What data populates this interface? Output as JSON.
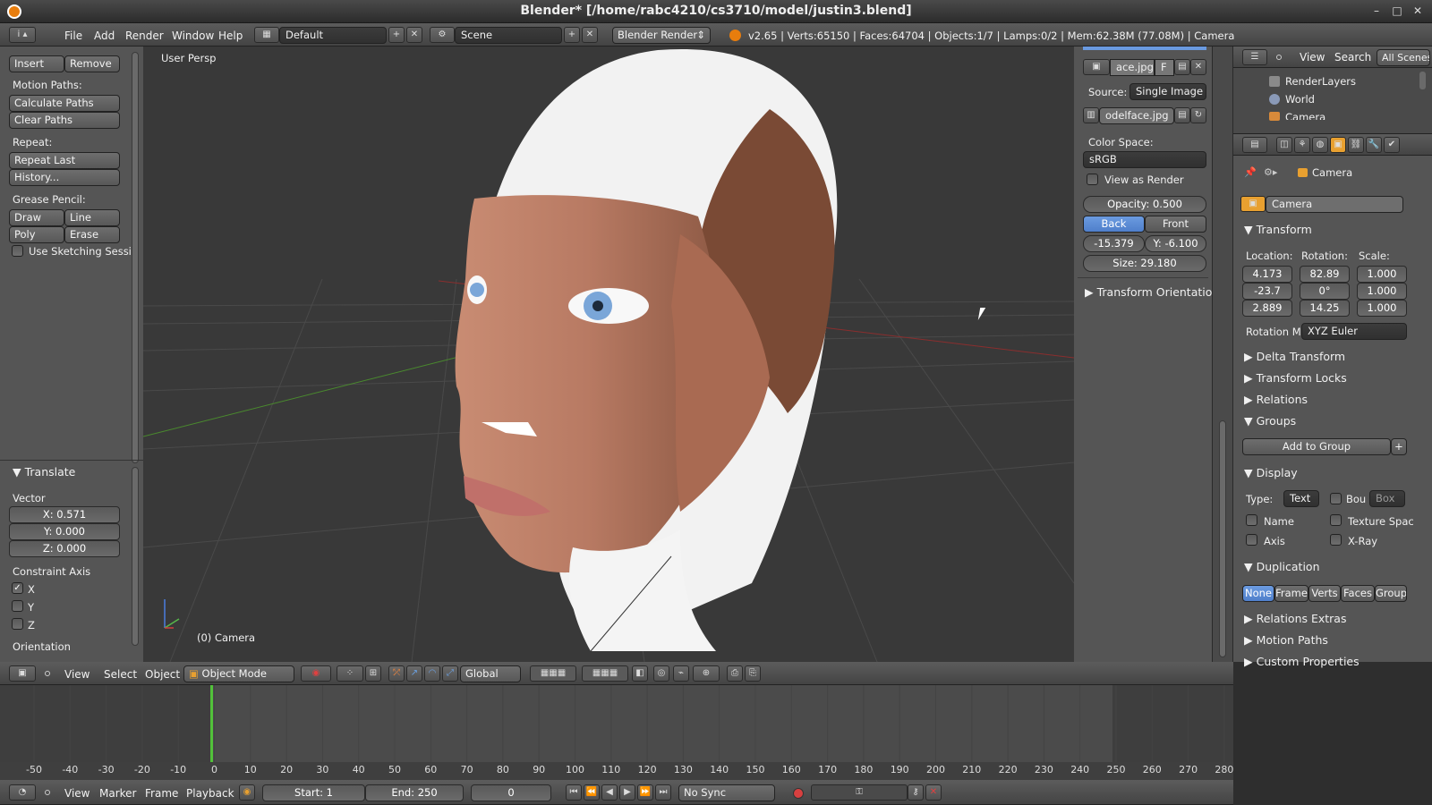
{
  "window": {
    "title": "Blender* [/home/rabc4210/cs3710/model/justin3.blend]"
  },
  "top_menu": {
    "file": "File",
    "add": "Add",
    "render": "Render",
    "window": "Window",
    "help": "Help",
    "layout": "Default",
    "scene": "Scene",
    "engine": "Blender Render",
    "info": "v2.65 | Verts:65150 | Faces:64704 | Objects:1/7 | Lamps:0/2 | Mem:62.38M (77.08M) | Camera"
  },
  "toolshelf": {
    "insert": "Insert",
    "remove": "Remove",
    "motion_paths": "Motion Paths:",
    "calculate_paths": "Calculate Paths",
    "clear_paths": "Clear Paths",
    "repeat": "Repeat:",
    "repeat_last": "Repeat Last",
    "history": "History...",
    "grease_pencil": "Grease Pencil:",
    "draw": "Draw",
    "line": "Line",
    "poly": "Poly",
    "erase": "Erase",
    "use_sketching": "Use Sketching Sessi"
  },
  "operator": {
    "title": "Translate",
    "vector": "Vector",
    "x": "X: 0.571",
    "y": "Y: 0.000",
    "z": "Z: 0.000",
    "constraint_axis": "Constraint Axis",
    "cx": "X",
    "cy": "Y",
    "cz": "Z",
    "orientation": "Orientation"
  },
  "viewport": {
    "label": "User Persp",
    "object": "(0) Camera"
  },
  "properties_panel": {
    "image": "ace.jpg",
    "f": "F",
    "source_label": "Source:",
    "source": "Single Image",
    "file": "odelface.jpg",
    "color_space_label": "Color Space:",
    "color_space": "sRGB",
    "view_as_render": "View as Render",
    "opacity": "Opacity: 0.500",
    "back": "Back",
    "front": "Front",
    "x": "-15.379",
    "y": "Y: -6.100",
    "size": "Size: 29.180",
    "transform_orientations": "Transform Orientations"
  },
  "outliner": {
    "view": "View",
    "search": "Search",
    "all_scenes": "All Scenes",
    "render_layers": "RenderLayers",
    "world": "World",
    "camera": "Camera"
  },
  "properties": {
    "breadcrumb": "Camera",
    "object_name": "Camera",
    "transform": "Transform",
    "location": "Location:",
    "rotation": "Rotation:",
    "scale": "Scale:",
    "loc": [
      "4.173",
      "-23.7",
      "2.889"
    ],
    "rot": [
      "82.89",
      "0°",
      "14.25"
    ],
    "scl": [
      "1.000",
      "1.000",
      "1.000"
    ],
    "rotation_mode_label": "Rotation M",
    "rotation_mode": "XYZ Euler",
    "delta_transform": "Delta Transform",
    "transform_locks": "Transform Locks",
    "relations": "Relations",
    "groups": "Groups",
    "add_to_group": "Add to Group",
    "display": "Display",
    "type_label": "Type:",
    "type": "Text",
    "bou": "Bou",
    "box": "Box",
    "name": "Name",
    "texture_space": "Texture Spac",
    "axis": "Axis",
    "xray": "X-Ray",
    "duplication": "Duplication",
    "dup_none": "None",
    "dup_frame": "Frame",
    "dup_verts": "Verts",
    "dup_faces": "Faces",
    "dup_group": "Group",
    "relations_extras": "Relations Extras",
    "motion_paths": "Motion Paths",
    "custom_properties": "Custom Properties"
  },
  "view3d_header": {
    "view": "View",
    "select": "Select",
    "object": "Object",
    "mode": "Object Mode",
    "orientation": "Global"
  },
  "timeline": {
    "ticks": [
      "-50",
      "-40",
      "-30",
      "-20",
      "-10",
      "0",
      "10",
      "20",
      "30",
      "40",
      "50",
      "60",
      "70",
      "80",
      "90",
      "100",
      "110",
      "120",
      "130",
      "140",
      "150",
      "160",
      "170",
      "180",
      "190",
      "200",
      "210",
      "220",
      "230",
      "240",
      "250",
      "260",
      "270",
      "280"
    ],
    "view": "View",
    "marker": "Marker",
    "frame": "Frame",
    "playback": "Playback",
    "start": "Start: 1",
    "end": "End: 250",
    "current": "0",
    "sync": "No Sync",
    "current_frame": 0
  }
}
